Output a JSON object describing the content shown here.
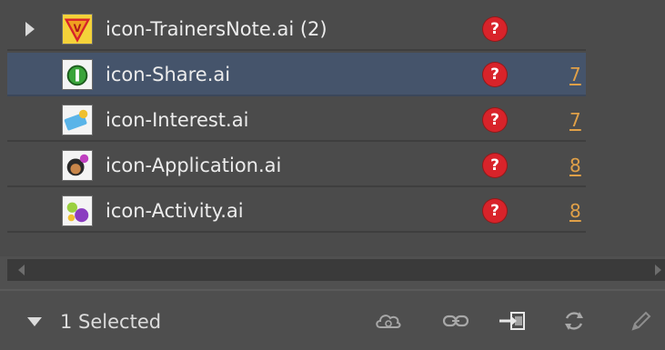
{
  "links": [
    {
      "name": "icon-TrainersNote.ai (2)",
      "page": "",
      "status": "missing",
      "has_children": true,
      "selected": false,
      "thumb": "trainers-note-thumbnail"
    },
    {
      "name": "icon-Share.ai",
      "page": "7",
      "status": "missing",
      "has_children": false,
      "selected": true,
      "thumb": "share-thumbnail"
    },
    {
      "name": "icon-Interest.ai",
      "page": "7",
      "status": "missing",
      "has_children": false,
      "selected": false,
      "thumb": "interest-thumbnail"
    },
    {
      "name": "icon-Application.ai",
      "page": "8",
      "status": "missing",
      "has_children": false,
      "selected": false,
      "thumb": "application-thumbnail"
    },
    {
      "name": "icon-Activity.ai",
      "page": "8",
      "status": "missing",
      "has_children": false,
      "selected": false,
      "thumb": "activity-thumbnail"
    }
  ],
  "status_glyph": "?",
  "footer": {
    "selected_label": "1 Selected",
    "tools": [
      "cc-libraries-icon",
      "relink-chain-icon",
      "go-to-link-icon",
      "update-link-icon",
      "edit-original-pencil-icon"
    ]
  },
  "colors": {
    "panel_bg": "#4b4b4b",
    "selected_row": "#45546b",
    "missing_badge": "#d8232a",
    "page_link": "#e0a048"
  }
}
